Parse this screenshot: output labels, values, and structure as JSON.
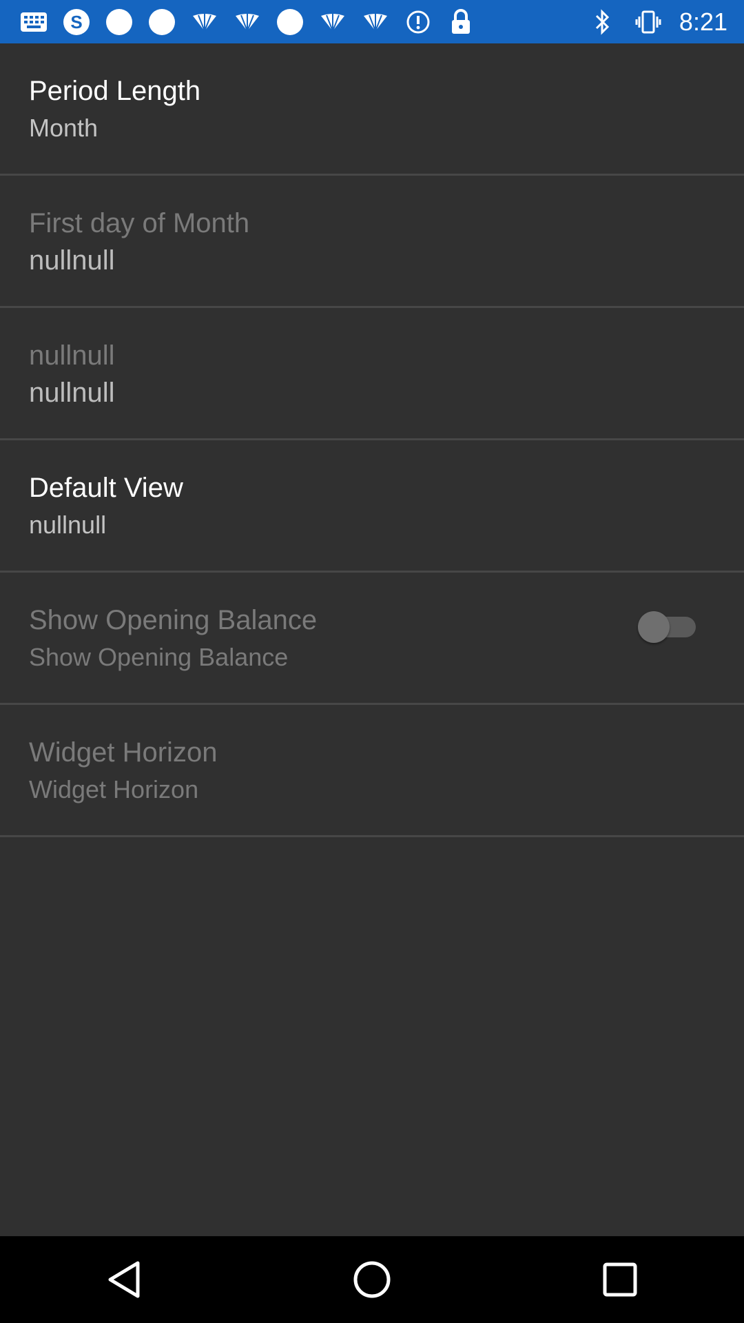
{
  "status_bar": {
    "time": "8:21",
    "left_icons": [
      "message-icon",
      "sync-app-icon",
      "circle-notification-icon",
      "circle-notification-icon",
      "fan-app-icon",
      "fan-app-icon",
      "circle-notification-icon",
      "fan-app-icon",
      "fan-app-icon",
      "info-icon",
      "lock-icon"
    ],
    "right_icons": [
      "bluetooth-icon",
      "vibrate-icon"
    ],
    "background": "#1565c0"
  },
  "settings": {
    "period_length": {
      "title": "Period Length",
      "summary": "Month"
    },
    "first_day": {
      "title": "First day of Month",
      "summary": "nullnull"
    },
    "unnamed": {
      "title": "nullnull",
      "summary": "nullnull"
    },
    "default_view": {
      "title": "Default View",
      "summary": "nullnull"
    },
    "opening_balance": {
      "title": "Show Opening Balance",
      "summary": "Show Opening Balance",
      "enabled": false
    },
    "widget_horizon": {
      "title": "Widget Horizon",
      "summary": "Widget Horizon"
    }
  },
  "nav_bar": {
    "icons": [
      "back-icon",
      "home-icon",
      "recents-icon"
    ]
  },
  "colors": {
    "background": "#303030",
    "divider": "#474747",
    "disabled_text": "#7a7a7a"
  }
}
